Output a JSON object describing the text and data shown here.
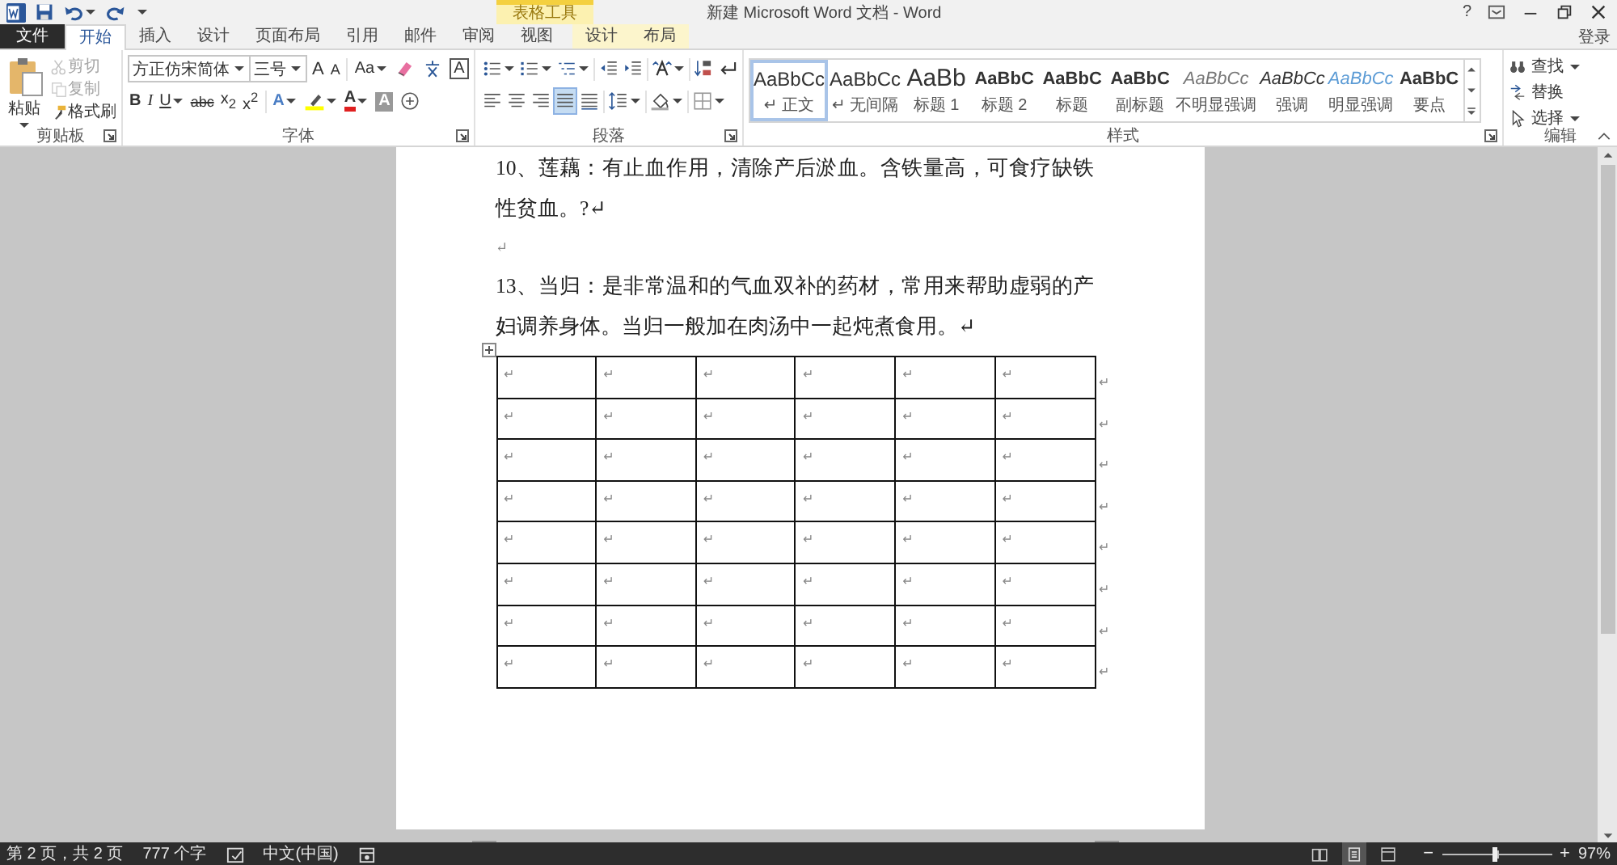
{
  "title_bar": {
    "title": "新建 Microsoft Word 文档 - Word",
    "contextual_title": "表格工具",
    "help": "?",
    "account": "登录"
  },
  "tabs": [
    {
      "label": "文件",
      "kind": "file",
      "selected": false
    },
    {
      "label": "开始",
      "kind": "normal",
      "selected": true
    },
    {
      "label": "插入",
      "kind": "normal",
      "selected": false
    },
    {
      "label": "设计",
      "kind": "normal",
      "selected": false
    },
    {
      "label": "页面布局",
      "kind": "normal",
      "selected": false
    },
    {
      "label": "引用",
      "kind": "normal",
      "selected": false
    },
    {
      "label": "邮件",
      "kind": "normal",
      "selected": false
    },
    {
      "label": "审阅",
      "kind": "normal",
      "selected": false
    },
    {
      "label": "视图",
      "kind": "normal",
      "selected": false
    },
    {
      "label": "设计",
      "kind": "contextual",
      "selected": false
    },
    {
      "label": "布局",
      "kind": "contextual",
      "selected": false
    }
  ],
  "ribbon": {
    "clipboard": {
      "label": "剪贴板",
      "paste": "粘贴",
      "items": [
        {
          "kind": "cut",
          "label": "剪切",
          "disabled": true
        },
        {
          "kind": "copy",
          "label": "复制",
          "disabled": true
        },
        {
          "kind": "painter",
          "label": "格式刷",
          "disabled": false
        }
      ]
    },
    "font": {
      "label": "字体",
      "font_name": "方正仿宋简体",
      "font_size": "三号",
      "row1": [
        {
          "kind": "grow",
          "label": "A"
        },
        {
          "kind": "shrink",
          "label": "A"
        },
        {
          "kind": "case",
          "label": "Aa",
          "dropdown": true
        },
        {
          "kind": "clear"
        },
        {
          "kind": "phonetic"
        },
        {
          "kind": "border",
          "label": "A"
        }
      ],
      "row2": [
        {
          "kind": "bold",
          "label": "B"
        },
        {
          "kind": "italic",
          "label": "I"
        },
        {
          "kind": "underline",
          "label": "U",
          "dropdown": true
        },
        {
          "kind": "strike",
          "label": "abc"
        },
        {
          "kind": "sub",
          "label": "x$_{2}$"
        },
        {
          "kind": "sup",
          "label": "x$^{2}$"
        },
        {
          "kind": "effects",
          "label": "A",
          "dropdown": true
        },
        {
          "kind": "highlight",
          "dropdown": true
        },
        {
          "kind": "color",
          "label": "A",
          "dropdown": true
        },
        {
          "kind": "shade",
          "label": "A"
        },
        {
          "kind": "enclose"
        }
      ]
    },
    "paragraph": {
      "label": "段落",
      "row1": [
        {
          "kind": "bullets",
          "dropdown": true
        },
        {
          "kind": "numbering",
          "dropdown": true
        },
        {
          "kind": "multilevel",
          "dropdown": true
        },
        {
          "kind": "outdent"
        },
        {
          "kind": "indent"
        },
        {
          "kind": "asian",
          "dropdown": true
        },
        {
          "kind": "sort"
        },
        {
          "kind": "marks"
        }
      ],
      "alignments": [
        {
          "kind": "left",
          "selected": false
        },
        {
          "kind": "center",
          "selected": false
        },
        {
          "kind": "right",
          "selected": false
        },
        {
          "kind": "justify",
          "selected": true
        },
        {
          "kind": "distributed",
          "selected": false
        }
      ],
      "row2": [
        {
          "kind": "spacing",
          "dropdown": true
        },
        {
          "kind": "shading",
          "dropdown": true
        },
        {
          "kind": "borders",
          "dropdown": true
        }
      ]
    },
    "styles": {
      "label": "样式",
      "items": [
        {
          "preview": "AaBbCc",
          "name": "↵ 正文",
          "kind": "normal",
          "selected": true
        },
        {
          "preview": "AaBbCc",
          "name": "↵ 无间隔",
          "kind": "normal",
          "selected": false
        },
        {
          "preview": "AaBb",
          "name": "标题 1",
          "kind": "heading1",
          "selected": false
        },
        {
          "preview": "AaBbC",
          "name": "标题 2",
          "kind": "heading2",
          "selected": false
        },
        {
          "preview": "AaBbC",
          "name": "标题",
          "kind": "heading2",
          "selected": false
        },
        {
          "preview": "AaBbC",
          "name": "副标题",
          "kind": "heading2",
          "selected": false
        },
        {
          "preview": "AaBbCc",
          "name": "不明显强调",
          "kind": "subtle",
          "selected": false
        },
        {
          "preview": "AaBbCc",
          "name": "强调",
          "kind": "emphasis",
          "selected": false
        },
        {
          "preview": "AaBbCc",
          "name": "明显强调",
          "kind": "intense",
          "selected": false
        },
        {
          "preview": "AaBbC",
          "name": "要点",
          "kind": "strong",
          "selected": false
        }
      ]
    },
    "editing": {
      "label": "编辑",
      "items": [
        {
          "kind": "find",
          "label": "查找",
          "dropdown": true
        },
        {
          "kind": "replace",
          "label": "替换",
          "dropdown": false
        },
        {
          "kind": "select",
          "label": "选择",
          "dropdown": true
        }
      ]
    }
  },
  "document": {
    "paragraphs": [
      "10、莲藕：有止血作用，清除产后淤血。含铁量高，可食疗缺铁性贫血。?↵",
      "↵",
      "13、当归：是非常温和的气血双补的药材，常用来帮助虚弱的产妇调养身体。当归一般加在肉汤中一起炖煮食用。↵"
    ],
    "table": {
      "rows": [
        {
          "cells": [
            "↵",
            "↵",
            "↵",
            "↵",
            "↵",
            "↵"
          ],
          "end_mark": "↵"
        },
        {
          "cells": [
            "↵",
            "↵",
            "↵",
            "↵",
            "↵",
            "↵"
          ],
          "end_mark": "↵"
        },
        {
          "cells": [
            "↵",
            "↵",
            "↵",
            "↵",
            "↵",
            "↵"
          ],
          "end_mark": "↵"
        },
        {
          "cells": [
            "↵",
            "↵",
            "↵",
            "↵",
            "↵",
            "↵"
          ],
          "end_mark": "↵"
        },
        {
          "cells": [
            "↵",
            "↵",
            "↵",
            "↵",
            "↵",
            "↵"
          ],
          "end_mark": "↵"
        },
        {
          "cells": [
            "↵",
            "↵",
            "↵",
            "↵",
            "↵",
            "↵"
          ],
          "end_mark": "↵"
        },
        {
          "cells": [
            "↵",
            "↵",
            "↵",
            "↵",
            "↵",
            "↵"
          ],
          "end_mark": "↵"
        },
        {
          "cells": [
            "↵",
            "↵",
            "↵",
            "↵",
            "↵",
            "↵"
          ],
          "end_mark": "↵"
        }
      ]
    }
  },
  "status_bar": {
    "page": "第 2 页，共 2 页",
    "words": "777 个字",
    "language": "中文(中国)",
    "views": [
      {
        "kind": "read",
        "selected": false
      },
      {
        "kind": "print",
        "selected": true
      },
      {
        "kind": "web",
        "selected": false
      }
    ],
    "zoom": {
      "minus": "−",
      "plus": "+",
      "level": 0.48,
      "value": "97%"
    }
  }
}
